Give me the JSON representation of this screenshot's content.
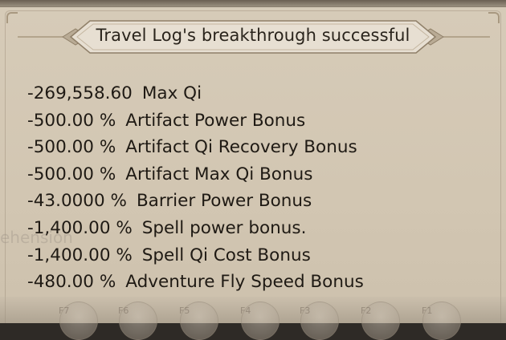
{
  "dialog": {
    "title": "Travel Log's breakthrough successful"
  },
  "stats": [
    {
      "value": "-269,558.60",
      "label": "Max Qi"
    },
    {
      "value": "-500.00 %",
      "label": "Artifact Power Bonus"
    },
    {
      "value": "-500.00 %",
      "label": "Artifact Qi Recovery Bonus"
    },
    {
      "value": "-500.00 %",
      "label": "Artifact Max Qi Bonus"
    },
    {
      "value": "-43.0000 %",
      "label": "Barrier Power Bonus"
    },
    {
      "value": "-1,400.00 %",
      "label": "Spell power bonus."
    },
    {
      "value": "-1,400.00 %",
      "label": "Spell Qi Cost Bonus"
    },
    {
      "value": "-480.00 %",
      "label": "Adventure Fly Speed Bonus"
    }
  ],
  "background": {
    "ghost_text": "ehension",
    "hotkeys": [
      "F7",
      "F6",
      "F5",
      "F4",
      "F3",
      "F2",
      "F1"
    ]
  },
  "colors": {
    "panel": "#d6cbb8",
    "banner": "#e6ddd0",
    "text": "#1f1a14"
  }
}
